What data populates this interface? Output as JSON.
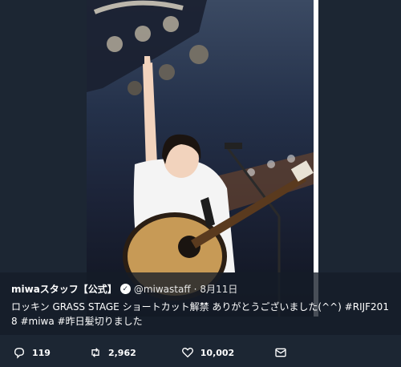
{
  "tweet": {
    "author_name": "miwaスタッフ【公式】",
    "handle": "@miwastaff",
    "separator": "·",
    "date": "8月11日",
    "text": "ロッキン GRASS STAGE ショートカット解禁 ありがとうございました(^^) #RIJF2018 #miwa #昨日髪切りました"
  },
  "actions": {
    "replies": "119",
    "retweets": "2,962",
    "likes": "10,002"
  },
  "icons": [
    "reply-icon",
    "retweet-icon",
    "like-icon",
    "message-icon",
    "verified-icon"
  ]
}
